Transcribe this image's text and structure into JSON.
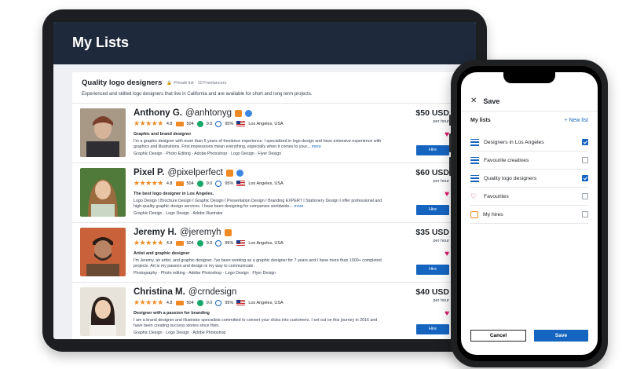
{
  "page": {
    "title": "My Lists"
  },
  "list": {
    "title": "Quality logo designers",
    "meta": "Private list · 10 Freelancers",
    "description": "Experienced and skilled logo designers that live in California and are available for short and long term projects."
  },
  "freelancers": [
    {
      "first": "Anthony G.",
      "handle": "@anhtonyg",
      "rating": "4.8",
      "reviews": "504",
      "earnings": "9.0",
      "completion": "95%",
      "location": "Los Angeles, USA",
      "tagline": "Graphic and brand designer",
      "description": "I'm a graphic designer with more than 6 years of freelance experience. I specialized in logo design and have extensive experience with graphics and illustrations. First impressions mean everything, especially when it comes to your...",
      "more": "more",
      "skills": "Graphic Design · Photo Editing · Adobe Photoshop · Logo Design · Flyer Design",
      "price": "$50 USD",
      "per": "per hour",
      "hire": "Hire"
    },
    {
      "first": "Pixel P.",
      "handle": "@pixelperfect",
      "rating": "4.8",
      "reviews": "504",
      "earnings": "9.0",
      "completion": "95%",
      "location": "Los Angeles, USA",
      "tagline": "The best logo designer in Los Angeles.",
      "description": "Logo Design I Brochure Design I Graphic Design I Presentation Design I Branding EXPERT I Stationery Design I offer professional and high-quality graphic design services. I have been designing for companies worldwide...",
      "more": "more",
      "skills": "Graphic Design · Logo Design · Adobe Illustrator",
      "price": "$60 USD",
      "per": "per hour",
      "hire": "Hire"
    },
    {
      "first": "Jeremy H.",
      "handle": "@jeremyh",
      "rating": "4.8",
      "reviews": "504",
      "earnings": "9.0",
      "completion": "95%",
      "location": "Los Angeles, USA",
      "tagline": "Artist and graphic designer",
      "description": "I'm Jeremy, an artist, and graphic designer. I've been working as a graphic designer for 7 years and I have more than 1000+ completed projects. Art is my passion and design is my way to communicate.",
      "more": "",
      "skills": "Photography · Photo editing · Adobe Photoshop · Logo Design · Flyer Design",
      "price": "$35 USD",
      "per": "per hour",
      "hire": "Hire"
    },
    {
      "first": "Christina M.",
      "handle": "@crndesign",
      "rating": "4.8",
      "reviews": "504",
      "earnings": "9.0",
      "completion": "95%",
      "location": "Los Angeles, USA",
      "tagline": "Designer with a passion for branding",
      "description": "I am a brand designer and illustrator specialists committed to convert your clicks into customers. I set out on this journey in 2016 and have been creating success stories since then.",
      "more": "",
      "skills": "Graphic Design · Logo Design · Adobe Photoshop",
      "price": "$40 USD",
      "per": "per hour",
      "hire": "Hire"
    }
  ],
  "phone": {
    "title": "Save",
    "section_label": "My lists",
    "new_list": "+ New list",
    "lists": [
      {
        "label": "Designers in Los Angeles",
        "icon": "list-icon",
        "checked": true
      },
      {
        "label": "Favourite creatives",
        "icon": "list-icon",
        "checked": false
      },
      {
        "label": "Quality logo designers",
        "icon": "list-icon",
        "checked": true
      },
      {
        "label": "Favourites",
        "icon": "heart-icon",
        "checked": false
      },
      {
        "label": "My hires",
        "icon": "briefcase-icon",
        "checked": false
      }
    ],
    "cancel": "Cancel",
    "save": "Save"
  },
  "colors": {
    "accent": "#1565c0",
    "header": "#1e2a3b",
    "star": "#f08a24",
    "heart": "#e1146e"
  }
}
